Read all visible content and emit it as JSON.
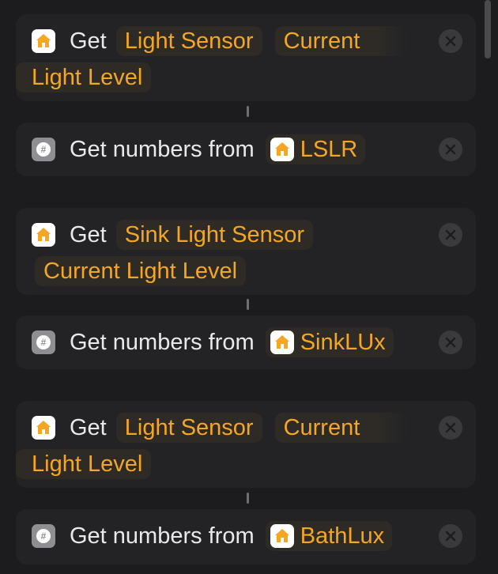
{
  "actions": [
    {
      "verb": "Get",
      "tokens": [
        "Light Sensor",
        "Current",
        "Light Level"
      ],
      "icon": "home-icon"
    },
    {
      "verb": "Get numbers from",
      "variable": "LSLR",
      "icon": "number-icon"
    },
    {
      "verb": "Get",
      "tokens": [
        "Sink Light Sensor",
        "Current Light Level"
      ],
      "icon": "home-icon"
    },
    {
      "verb": "Get numbers from",
      "variable": "SinkLUx",
      "icon": "number-icon"
    },
    {
      "verb": "Get",
      "tokens": [
        "Light Sensor",
        "Current",
        "Light Level"
      ],
      "icon": "home-icon"
    },
    {
      "verb": "Get numbers from",
      "variable": "BathLux",
      "icon": "number-icon"
    }
  ],
  "number_glyph": "#",
  "colors": {
    "background": "#1c1c1e",
    "card": "#232325",
    "text": "#e9e9eb",
    "accent": "#f5a623",
    "home_icon": "#f5a623",
    "number_icon": "#8e8e93"
  }
}
